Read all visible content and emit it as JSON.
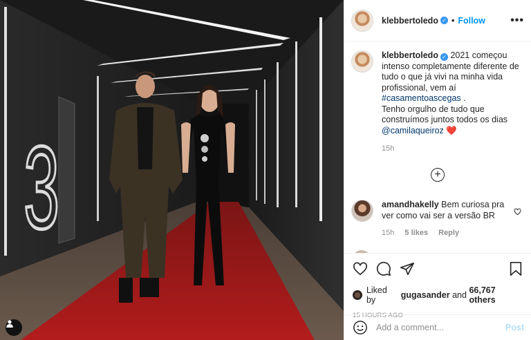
{
  "post": {
    "username": "klebbertoledo",
    "follow_label": "Follow",
    "more_icon": "more-options-icon",
    "verified_icon": "verified-badge-icon",
    "caption": {
      "text_before": "2021 começou intenso completamente diferente de tudo o que já vivi na minha vida profissional, vem aí",
      "hashtag": "#casamentoascegas",
      "text_after": ".",
      "line2": "Tenho orgulho de tudo que construímos juntos todos os dias",
      "mention": "@camilaqueiroz",
      "emoji": "❤️",
      "time": "15h"
    },
    "load_more_icon": "plus-circle-icon",
    "comments": [
      {
        "username": "amandhakelly",
        "text": "Bem curiosa pra ver como vai ser a versão BR",
        "time": "15h",
        "likes": "5 likes",
        "reply": "Reply"
      }
    ],
    "liked_by_prefix": "Liked by",
    "liked_by_user": "gugasander",
    "liked_by_and": "and",
    "liked_by_count": "66,767 others",
    "time_ago": "15 HOURS AGO",
    "add_comment_placeholder": "Add a comment...",
    "post_label": "Post"
  },
  "colors": {
    "link": "#0095f6",
    "hashtag": "#00376b",
    "muted": "#8e8e8e",
    "carpet": "#b31c1c",
    "heart": "#ed4956"
  }
}
